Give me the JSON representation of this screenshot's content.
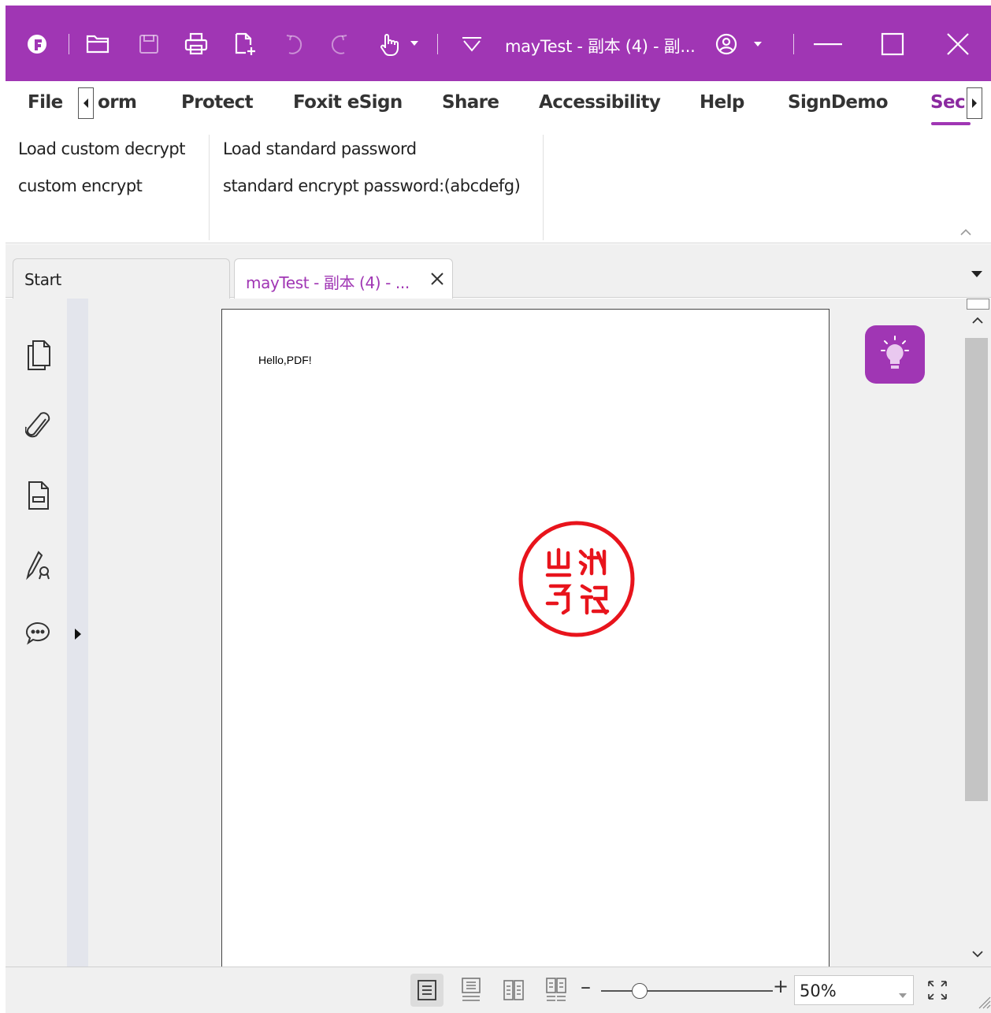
{
  "window": {
    "title": "mayTest - 副本 (4) - 副...",
    "accent_color": "#a036b4",
    "quick_access": [
      "foxit-logo-icon",
      "open-folder-icon",
      "save-icon",
      "print-icon",
      "new-doc-icon",
      "undo-icon",
      "redo-icon",
      "hand-tool-icon",
      "customize-icon",
      "account-icon"
    ],
    "controls": [
      "minimize-icon",
      "maximize-icon",
      "close-icon"
    ]
  },
  "ribbon": {
    "tabs": [
      "File",
      "Form",
      "Protect",
      "Foxit eSign",
      "Share",
      "Accessibility",
      "Help",
      "SignDemo",
      "Security"
    ],
    "form_tab_visible": "orm",
    "security_tab_visible": "Sec",
    "active_tab": "Security",
    "groups": [
      {
        "commands": [
          "Load custom decrypt",
          "custom encrypt"
        ]
      },
      {
        "commands": [
          "Load standard password",
          "standard encrypt password:(abcdefg)"
        ]
      }
    ]
  },
  "doc_tabs": [
    {
      "label": "Start",
      "active": false
    },
    {
      "label": "mayTest - 副本 (4) - ...",
      "active": true
    }
  ],
  "left_nav": [
    "pages-icon",
    "attachment-icon",
    "layers-icon",
    "signature-icon",
    "comments-icon"
  ],
  "document": {
    "text": "Hello,PDF!",
    "stamp_color": "#e8141c"
  },
  "status_bar": {
    "view_modes": [
      "single-page-icon",
      "continuous-page-icon",
      "facing-page-icon",
      "continuous-facing-icon"
    ],
    "zoom_value": "50%",
    "zoom_level": 0.18
  }
}
